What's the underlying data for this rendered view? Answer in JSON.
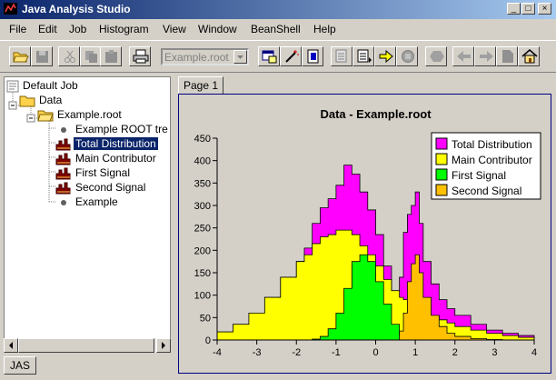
{
  "window": {
    "title": "Java Analysis Studio",
    "controls": [
      "_",
      "□",
      "×"
    ]
  },
  "menubar": {
    "items": [
      {
        "label": "File",
        "key": "F"
      },
      {
        "label": "Edit",
        "key": "E"
      },
      {
        "label": "Job",
        "key": "J"
      },
      {
        "label": "Histogram",
        "key": "H"
      },
      {
        "label": "View",
        "key": "V"
      },
      {
        "label": "Window",
        "key": "W"
      },
      {
        "label": "BeanShell",
        "key": "B"
      },
      {
        "label": "Help",
        "key": "H"
      }
    ]
  },
  "toolbar": {
    "combo_value": "Example.root",
    "icons": [
      "open-folder-icon",
      "save-icon",
      "cut-icon",
      "copy-icon",
      "paste-icon",
      "print-icon",
      "new-plot-icon",
      "wand-icon",
      "script-icon",
      "page-icon",
      "list-icon",
      "step-arrow-icon",
      "stop-icon",
      "hexagon-icon",
      "back-arrow-icon",
      "forward-arrow-icon",
      "document-icon",
      "home-icon"
    ]
  },
  "tree": {
    "root": "Default Job",
    "data": "Data",
    "file": "Example.root",
    "items": [
      {
        "label": "Example ROOT tre",
        "icon": "bullet"
      },
      {
        "label": "Total Distribution",
        "icon": "histogram",
        "selected": true
      },
      {
        "label": "Main Contributor",
        "icon": "histogram"
      },
      {
        "label": "First Signal",
        "icon": "histogram"
      },
      {
        "label": "Second Signal",
        "icon": "histogram"
      },
      {
        "label": "Example",
        "icon": "bullet"
      }
    ]
  },
  "bottom_tab": "JAS",
  "page_tab": "Page 1",
  "colors": {
    "total": "#ff00ff",
    "main": "#ffff00",
    "first": "#00ff00",
    "second": "#ffc000"
  },
  "chart_data": {
    "type": "area",
    "title": "Data - Example.root",
    "xlim": [
      -4,
      4
    ],
    "ylim": [
      0,
      450
    ],
    "x_ticks": [
      -4,
      -3,
      -2,
      -1,
      0,
      1,
      2,
      3,
      4
    ],
    "y_ticks": [
      0,
      50,
      100,
      150,
      200,
      250,
      300,
      350,
      400,
      450
    ],
    "legend_position": "top-right",
    "x": [
      -4.0,
      -3.6,
      -3.2,
      -2.8,
      -2.4,
      -2.0,
      -1.8,
      -1.6,
      -1.4,
      -1.2,
      -1.0,
      -0.8,
      -0.6,
      -0.4,
      -0.2,
      0.0,
      0.2,
      0.4,
      0.6,
      0.7,
      0.8,
      0.9,
      1.0,
      1.1,
      1.2,
      1.4,
      1.6,
      1.8,
      2.0,
      2.4,
      2.8,
      3.2,
      3.6,
      4.0
    ],
    "series": [
      {
        "name": "Total Distribution",
        "values": [
          18,
          35,
          60,
          95,
          140,
          175,
          205,
          260,
          295,
          315,
          345,
          390,
          370,
          330,
          290,
          235,
          165,
          110,
          140,
          240,
          280,
          300,
          330,
          260,
          175,
          125,
          90,
          70,
          55,
          35,
          22,
          15,
          10,
          5
        ]
      },
      {
        "name": "Main Contributor",
        "values": [
          18,
          35,
          60,
          95,
          140,
          175,
          190,
          215,
          230,
          235,
          245,
          245,
          235,
          210,
          190,
          165,
          135,
          110,
          95,
          90,
          85,
          80,
          75,
          70,
          65,
          55,
          45,
          38,
          30,
          22,
          15,
          10,
          6,
          3
        ]
      },
      {
        "name": "First Signal",
        "values": [
          0,
          0,
          0,
          0,
          0,
          0,
          0,
          2,
          8,
          25,
          60,
          115,
          175,
          190,
          175,
          130,
          80,
          35,
          10,
          4,
          1,
          0,
          0,
          0,
          0,
          0,
          0,
          0,
          0,
          0,
          0,
          0,
          0,
          0
        ]
      },
      {
        "name": "Second Signal",
        "values": [
          0,
          0,
          0,
          0,
          0,
          0,
          0,
          0,
          0,
          0,
          0,
          0,
          0,
          0,
          0,
          0,
          0,
          0,
          20,
          60,
          130,
          170,
          190,
          150,
          95,
          55,
          30,
          15,
          8,
          3,
          1,
          0,
          0,
          0
        ]
      }
    ]
  }
}
